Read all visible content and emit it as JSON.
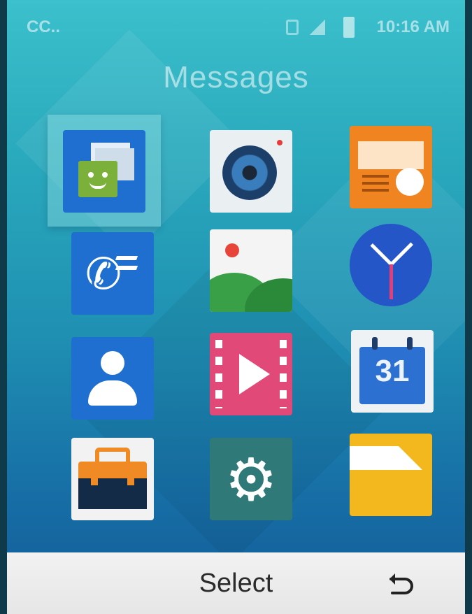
{
  "status_bar": {
    "carrier": "CC..",
    "time": "10:16 AM",
    "icons": [
      "sim-icon",
      "signal-icon",
      "battery-icon"
    ]
  },
  "title": "Messages",
  "apps": [
    {
      "name": "messages",
      "icon": "messages-icon",
      "focused": true
    },
    {
      "name": "camera",
      "icon": "camera-icon"
    },
    {
      "name": "radio",
      "icon": "radio-icon"
    },
    {
      "name": "call-log",
      "icon": "call-log-icon"
    },
    {
      "name": "gallery",
      "icon": "gallery-icon"
    },
    {
      "name": "clock",
      "icon": "clock-icon"
    },
    {
      "name": "contacts",
      "icon": "contacts-icon"
    },
    {
      "name": "video",
      "icon": "video-icon"
    },
    {
      "name": "calendar",
      "icon": "calendar-icon",
      "text": "31"
    },
    {
      "name": "tools",
      "icon": "tools-icon"
    },
    {
      "name": "settings",
      "icon": "settings-icon"
    },
    {
      "name": "files",
      "icon": "files-icon"
    }
  ],
  "softkeys": {
    "center": "Select",
    "right_icon": "back-icon"
  },
  "colors": {
    "background_top": "#3cc0cc",
    "background_bottom": "#135b98",
    "softkey_bar": "#eeeeee",
    "focus_highlight": "#aaebeb"
  }
}
